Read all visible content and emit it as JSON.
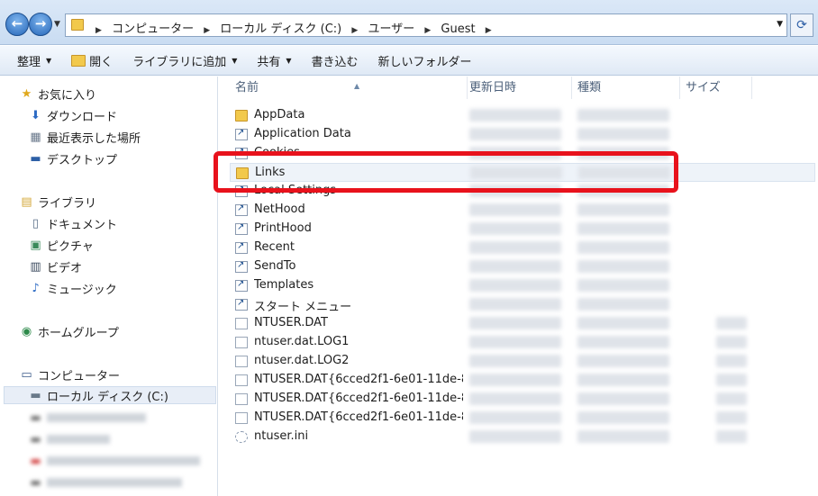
{
  "address": {
    "crumbs": [
      "コンピューター",
      "ローカル ディスク (C:)",
      "ユーザー",
      "Guest"
    ]
  },
  "toolbar": {
    "organize": "整理",
    "open": "開く",
    "add_library": "ライブラリに追加",
    "share": "共有",
    "burn": "書き込む",
    "new_folder": "新しいフォルダー"
  },
  "nav": {
    "favorites": "お気に入り",
    "downloads": "ダウンロード",
    "recent": "最近表示した場所",
    "desktop": "デスクトップ",
    "libraries": "ライブラリ",
    "documents": "ドキュメント",
    "pictures": "ピクチャ",
    "videos": "ビデオ",
    "music": "ミュージック",
    "homegroup": "ホームグループ",
    "computer": "コンピューター",
    "local_disk": "ローカル ディスク (C:)"
  },
  "columns": {
    "name": "名前",
    "date": "更新日時",
    "type": "種類",
    "size": "サイズ"
  },
  "files": [
    {
      "name": "AppData",
      "icon": "folder-icon"
    },
    {
      "name": "Application Data",
      "icon": "shortcut-icon"
    },
    {
      "name": "Cookies",
      "icon": "shortcut-icon"
    },
    {
      "name": "Links",
      "icon": "folder-icon"
    },
    {
      "name": "Local Settings",
      "icon": "shortcut-icon"
    },
    {
      "name": "NetHood",
      "icon": "shortcut-icon"
    },
    {
      "name": "PrintHood",
      "icon": "shortcut-icon"
    },
    {
      "name": "Recent",
      "icon": "shortcut-icon"
    },
    {
      "name": "SendTo",
      "icon": "shortcut-icon"
    },
    {
      "name": "Templates",
      "icon": "shortcut-icon"
    },
    {
      "name": "スタート メニュー",
      "icon": "shortcut-icon"
    },
    {
      "name": "NTUSER.DAT",
      "icon": "file-icon"
    },
    {
      "name": "ntuser.dat.LOG1",
      "icon": "file-icon"
    },
    {
      "name": "ntuser.dat.LOG2",
      "icon": "file-icon"
    },
    {
      "name": "NTUSER.DAT{6cced2f1-6e01-11de-8...",
      "icon": "file-icon"
    },
    {
      "name": "NTUSER.DAT{6cced2f1-6e01-11de-8...",
      "icon": "file-icon"
    },
    {
      "name": "NTUSER.DAT{6cced2f1-6e01-11de-8...",
      "icon": "file-icon"
    },
    {
      "name": "ntuser.ini",
      "icon": "settings-file-icon"
    }
  ],
  "colors": {
    "highlight": "#e8121c"
  }
}
